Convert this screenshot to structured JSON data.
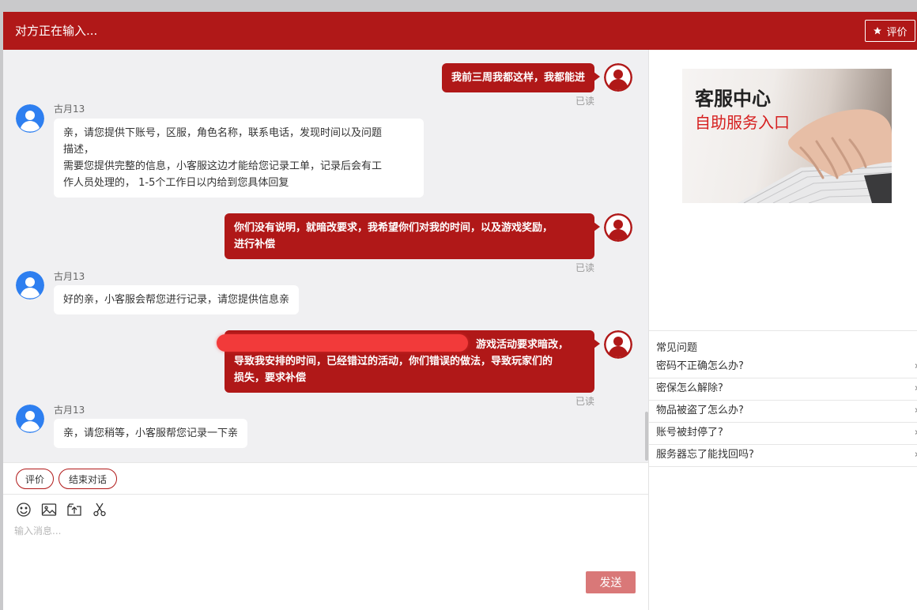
{
  "header": {
    "title": "对方正在输入...",
    "rate_label": "评价"
  },
  "messages": [
    {
      "type": "user",
      "text": "我前三周我都这样，我都能进",
      "status": "已读"
    },
    {
      "type": "agent",
      "name": "古月13",
      "lines": [
        "亲，请您提供下账号，区服，角色名称，联系电话，发现时间以及问题",
        "描述，",
        "需要您提供完整的信息，小客服这边才能给您记录工单，记录后会有工",
        "作人员处理的， 1-5个工作日以内给到您具体回复"
      ]
    },
    {
      "type": "user",
      "lines": [
        "你们没有说明，就暗改要求，我希望你们对我的时间，以及游戏奖励，",
        "进行补偿"
      ],
      "status": "已读"
    },
    {
      "type": "agent",
      "name": "古月13",
      "text": "好的亲，小客服会帮您进行记录，请您提供信息亲"
    },
    {
      "type": "user",
      "lines": [
        "游戏活动要求暗改，",
        "导致我安排的时间，已经错过的活动，你们错误的做法，导致玩家们的",
        "损失，要求补偿"
      ],
      "status": "已读"
    },
    {
      "type": "agent",
      "name": "古月13",
      "text": "亲，请您稍等，小客服帮您记录一下亲"
    }
  ],
  "quick_actions": {
    "rate": "评价",
    "end_chat": "结束对话"
  },
  "toolbar": {
    "icons": [
      "emoji-icon",
      "image-icon",
      "upload-icon",
      "scissors-icon"
    ]
  },
  "input": {
    "placeholder": "输入消息...",
    "send_label": "发送"
  },
  "sidebar": {
    "banner": {
      "title": "客服中心",
      "subtitle": "自助服务入口"
    },
    "faq_title": "常见问题",
    "faq": [
      "密码不正确怎么办?",
      "密保怎么解除?",
      "物品被盗了怎么办?",
      "账号被封停了?",
      "服务器忘了能找回吗?"
    ]
  },
  "colors": {
    "brand": "#b01818",
    "send_disabled": "#d97878",
    "agent_avatar": "#2e7ff0",
    "chat_bg": "#f0f0f2"
  }
}
